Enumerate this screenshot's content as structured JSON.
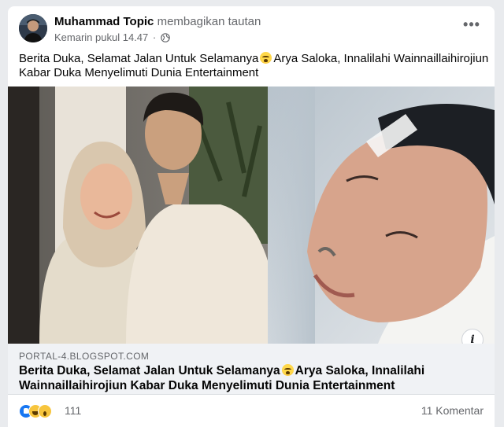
{
  "post": {
    "author": "Muhammad Topic",
    "action": "membagikan tautan",
    "timestamp": "Kemarin pukul 14.47",
    "separator": "·",
    "privacy_icon": "globe-icon",
    "more_icon": "more-horizontal-icon",
    "more_label": "•••",
    "text_line1_a": "Berita Duka, Selamat Jalan Untuk Selamanya",
    "text_line1_b": "Arya Saloka, Innalilahi Wainnaillaihirojiun",
    "text_line2": "Kabar Duka Menyelimuti Dunia Entertainment",
    "emoji_icon": "crying-face-emoji"
  },
  "link": {
    "info_icon": "info-icon",
    "info_label": "i",
    "domain": "PORTAL-4.BLOGSPOT.COM",
    "title_line1_a": "Berita Duka, Selamat Jalan Untuk Selamanya",
    "title_line1_b": "Arya Saloka, Innalilahi",
    "title_line2": "Wainnaillaihirojiun Kabar Duka Menyelimuti Dunia Entertainment"
  },
  "footer": {
    "reaction_icons": [
      "like-icon",
      "haha-icon",
      "wow-icon"
    ],
    "reaction_count": "111",
    "comments": "11 Komentar"
  },
  "colors": {
    "accent": "#1877f2",
    "secondary_text": "#65676b",
    "link_bg": "#f0f2f5"
  }
}
